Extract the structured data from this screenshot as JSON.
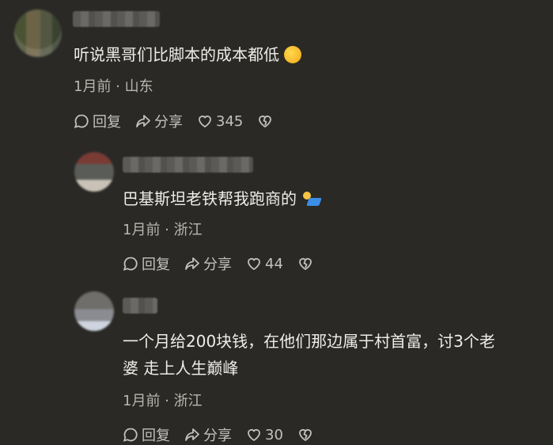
{
  "comments": [
    {
      "text": "听说黑哥们比脚本的成本都低",
      "meta": "1月前 · 山东",
      "reply_label": "回复",
      "share_label": "分享",
      "likes": "345"
    },
    {
      "text": "巴基斯坦老铁帮我跑商的",
      "meta": "1月前 · 浙江",
      "reply_label": "回复",
      "share_label": "分享",
      "likes": "44"
    },
    {
      "text_line1": "一个月给200块钱，在他们那边属于村首富，讨3个老",
      "text_line2": "婆 走上人生巅峰",
      "meta": "1月前 · 浙江",
      "reply_label": "回复",
      "share_label": "分享",
      "likes": "30"
    }
  ],
  "icons": {
    "reply": "comment-bubble-icon",
    "share": "share-arrow-icon",
    "like": "heart-icon",
    "dislike": "broken-heart-icon",
    "emoji1": "thinking-face-emoji",
    "emoji2": "running-person-emoji"
  }
}
